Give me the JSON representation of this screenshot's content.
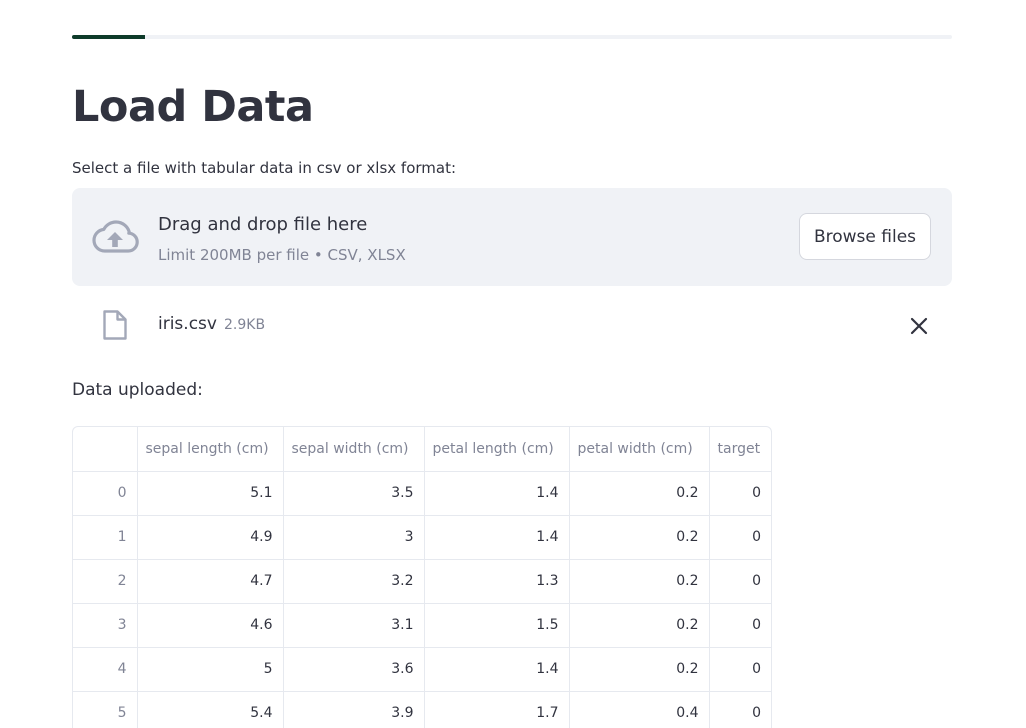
{
  "progress": {
    "fraction": 0.083
  },
  "page": {
    "title": "Load Data"
  },
  "uploader": {
    "label": "Select a file with tabular data in csv or xlsx format:",
    "drop_text": "Drag and drop file here",
    "limit_text": "Limit 200MB per file • CSV, XLSX",
    "browse_label": "Browse files",
    "icon": "cloud-upload-icon"
  },
  "file": {
    "name": "iris.csv",
    "size": "2.9KB",
    "icon": "file-icon",
    "remove_icon": "close-icon"
  },
  "data_label": "Data uploaded:",
  "table": {
    "columns": [
      "",
      "sepal length (cm)",
      "sepal width (cm)",
      "petal length (cm)",
      "petal width (cm)",
      "target"
    ],
    "rows": [
      [
        "0",
        "5.1",
        "3.5",
        "1.4",
        "0.2",
        "0"
      ],
      [
        "1",
        "4.9",
        "3",
        "1.4",
        "0.2",
        "0"
      ],
      [
        "2",
        "4.7",
        "3.2",
        "1.3",
        "0.2",
        "0"
      ],
      [
        "3",
        "4.6",
        "3.1",
        "1.5",
        "0.2",
        "0"
      ],
      [
        "4",
        "5",
        "3.6",
        "1.4",
        "0.2",
        "0"
      ],
      [
        "5",
        "5.4",
        "3.9",
        "1.7",
        "0.4",
        "0"
      ]
    ]
  },
  "colors": {
    "progress_fill": "#0e3b2a",
    "progress_track": "#f0f2f6",
    "dropzone_bg": "#f0f2f6",
    "text": "#31333f",
    "muted_text": "#808495",
    "icon": "#a3a8b8"
  }
}
